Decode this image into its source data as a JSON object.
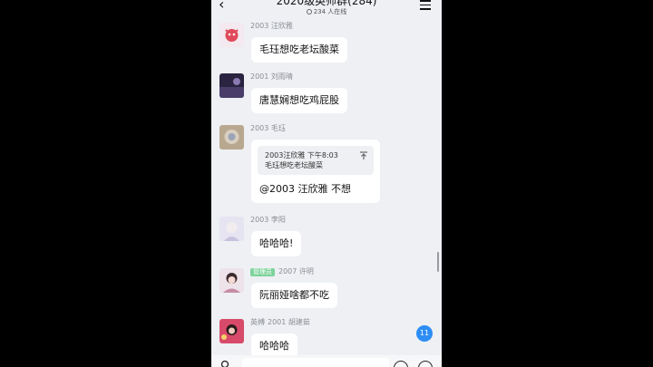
{
  "header": {
    "title": "2020级英师群(284)",
    "online": "234 人在线"
  },
  "messages": [
    {
      "sender": "2003 汪欣雅",
      "text": "毛珏想吃老坛酸菜"
    },
    {
      "sender": "2001 刘雨晴",
      "text": "唐慧娴想吃鸡屁股"
    },
    {
      "sender": "2003 毛珏",
      "quote_header": "2003汪欣雅 下午8:03",
      "quote_text": "毛珏想吃老坛酸菜",
      "text": "@2003 汪欣雅 不想"
    },
    {
      "sender": "2003 李阳",
      "text": "哈哈哈!"
    },
    {
      "badge": "管理员",
      "sender": "2007 许明",
      "text": "阮丽娅啥都不吃"
    },
    {
      "title_tag": "英缚",
      "sender": "2001 胡建茹",
      "text": "哈哈哈"
    }
  ],
  "unread_count": "11",
  "colors": {
    "bubble": "#ffffff",
    "background": "#eef0f4",
    "badge": "#7ed39b",
    "unread": "#2d8df5"
  }
}
